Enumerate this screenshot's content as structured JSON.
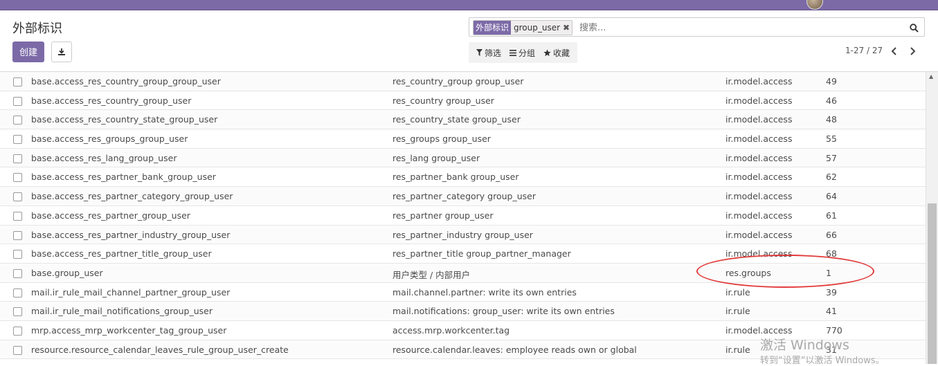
{
  "app": {
    "page_title": "外部标识",
    "create_label": "创建",
    "colors": {
      "brand": "#7c6aa7",
      "annotation": "#e23b3b"
    }
  },
  "search": {
    "facet_label": "外部标识",
    "facet_value": "group_user",
    "placeholder": "搜索..."
  },
  "filters": {
    "filter_label": "筛选",
    "group_label": "分组",
    "favorites_label": "收藏"
  },
  "pager": {
    "range": "1-27 / 27"
  },
  "rows": [
    {
      "id": "base.access_res_country_group_group_user",
      "name": "res_country_group group_user",
      "model": "ir.model.access",
      "rid": "49"
    },
    {
      "id": "base.access_res_country_group_user",
      "name": "res_country group_user",
      "model": "ir.model.access",
      "rid": "46"
    },
    {
      "id": "base.access_res_country_state_group_user",
      "name": "res_country_state group_user",
      "model": "ir.model.access",
      "rid": "48"
    },
    {
      "id": "base.access_res_groups_group_user",
      "name": "res_groups group_user",
      "model": "ir.model.access",
      "rid": "55"
    },
    {
      "id": "base.access_res_lang_group_user",
      "name": "res_lang group_user",
      "model": "ir.model.access",
      "rid": "57"
    },
    {
      "id": "base.access_res_partner_bank_group_user",
      "name": "res_partner_bank group_user",
      "model": "ir.model.access",
      "rid": "62"
    },
    {
      "id": "base.access_res_partner_category_group_user",
      "name": "res_partner_category group_user",
      "model": "ir.model.access",
      "rid": "64"
    },
    {
      "id": "base.access_res_partner_group_user",
      "name": "res_partner group_user",
      "model": "ir.model.access",
      "rid": "61"
    },
    {
      "id": "base.access_res_partner_industry_group_user",
      "name": "res_partner_industry group_user",
      "model": "ir.model.access",
      "rid": "66"
    },
    {
      "id": "base.access_res_partner_title_group_user",
      "name": "res_partner_title group_partner_manager",
      "model": "ir.model.access",
      "rid": "68"
    },
    {
      "id": "base.group_user",
      "name": "用户类型 / 内部用户",
      "model": "res.groups",
      "rid": "1"
    },
    {
      "id": "mail.ir_rule_mail_channel_partner_group_user",
      "name": "mail.channel.partner: write its own entries",
      "model": "ir.rule",
      "rid": "39"
    },
    {
      "id": "mail.ir_rule_mail_notifications_group_user",
      "name": "mail.notifications: group_user: write its own entries",
      "model": "ir.rule",
      "rid": "41"
    },
    {
      "id": "mrp.access_mrp_workcenter_tag_group_user",
      "name": "access.mrp.workcenter.tag",
      "model": "ir.model.access",
      "rid": "770"
    },
    {
      "id": "resource.resource_calendar_leaves_rule_group_user_create",
      "name": "resource.calendar.leaves: employee reads own or global",
      "model": "ir.rule",
      "rid": "31"
    }
  ],
  "watermark": {
    "line1": "激活 Windows",
    "line2": "转到“设置”以激活 Windows。"
  }
}
